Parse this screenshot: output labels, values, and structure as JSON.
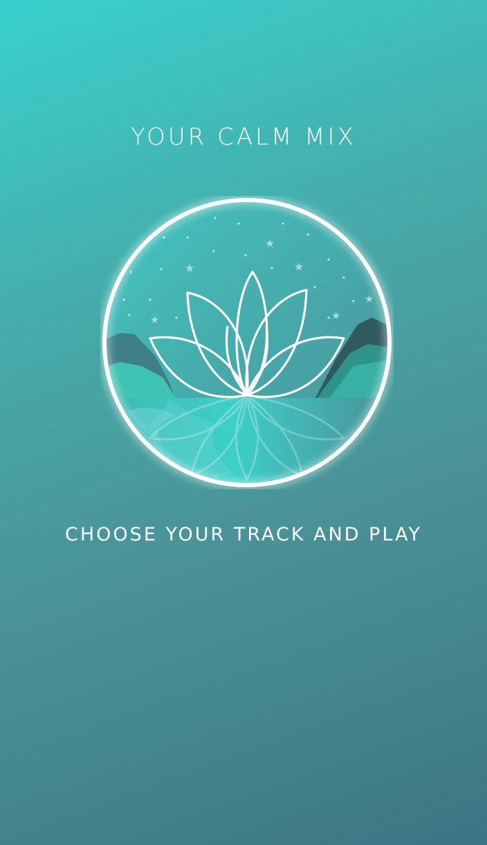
{
  "header": {
    "title": "YOUR CALM MIX"
  },
  "emblem": {
    "icon": "lotus-icon",
    "accent": "#3ecfc9",
    "ring": "#ffffff"
  },
  "footer": {
    "instruction": "CHOOSE YOUR TRACK AND PLAY"
  }
}
